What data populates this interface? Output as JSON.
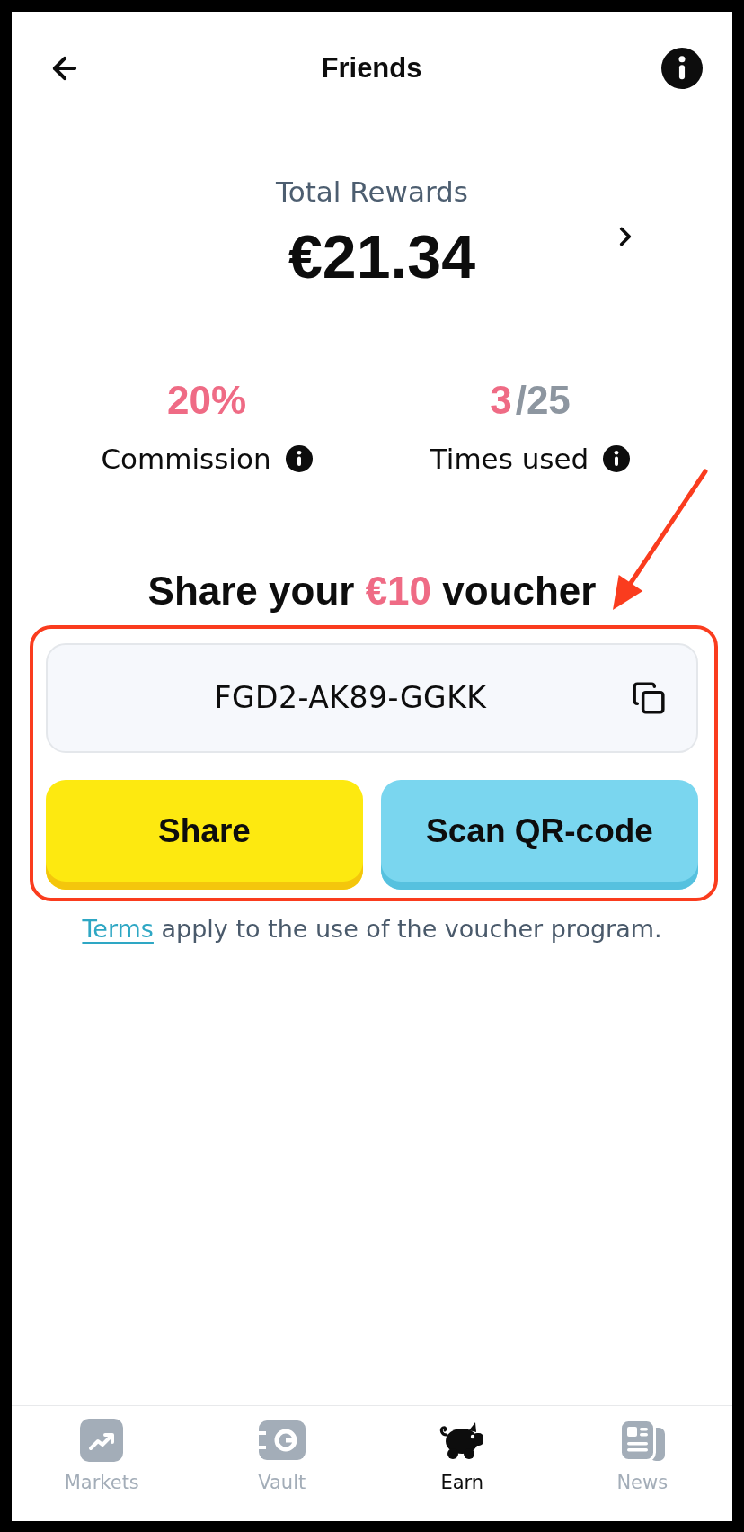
{
  "header": {
    "title": "Friends"
  },
  "rewards": {
    "label": "Total Rewards",
    "amount": "€21.34"
  },
  "stats": [
    {
      "value": "20%",
      "label": "Commission"
    },
    {
      "value": "3",
      "total": "/25",
      "label": "Times used"
    }
  ],
  "voucher": {
    "heading": {
      "before": "Share your",
      "amount": "€10",
      "after": "voucher"
    },
    "code": "FGD2-AK89-GGKK",
    "buttons": [
      {
        "kind": "share",
        "label": "Share"
      },
      {
        "kind": "scan",
        "label": "Scan QR-code"
      }
    ],
    "terms": {
      "link": "Terms",
      "text": "apply to the use of the voucher program."
    }
  },
  "nav": [
    {
      "label": "Markets",
      "selected": false
    },
    {
      "label": "Vault",
      "selected": false
    },
    {
      "label": "Earn",
      "selected": true
    },
    {
      "label": "News",
      "selected": false
    }
  ]
}
